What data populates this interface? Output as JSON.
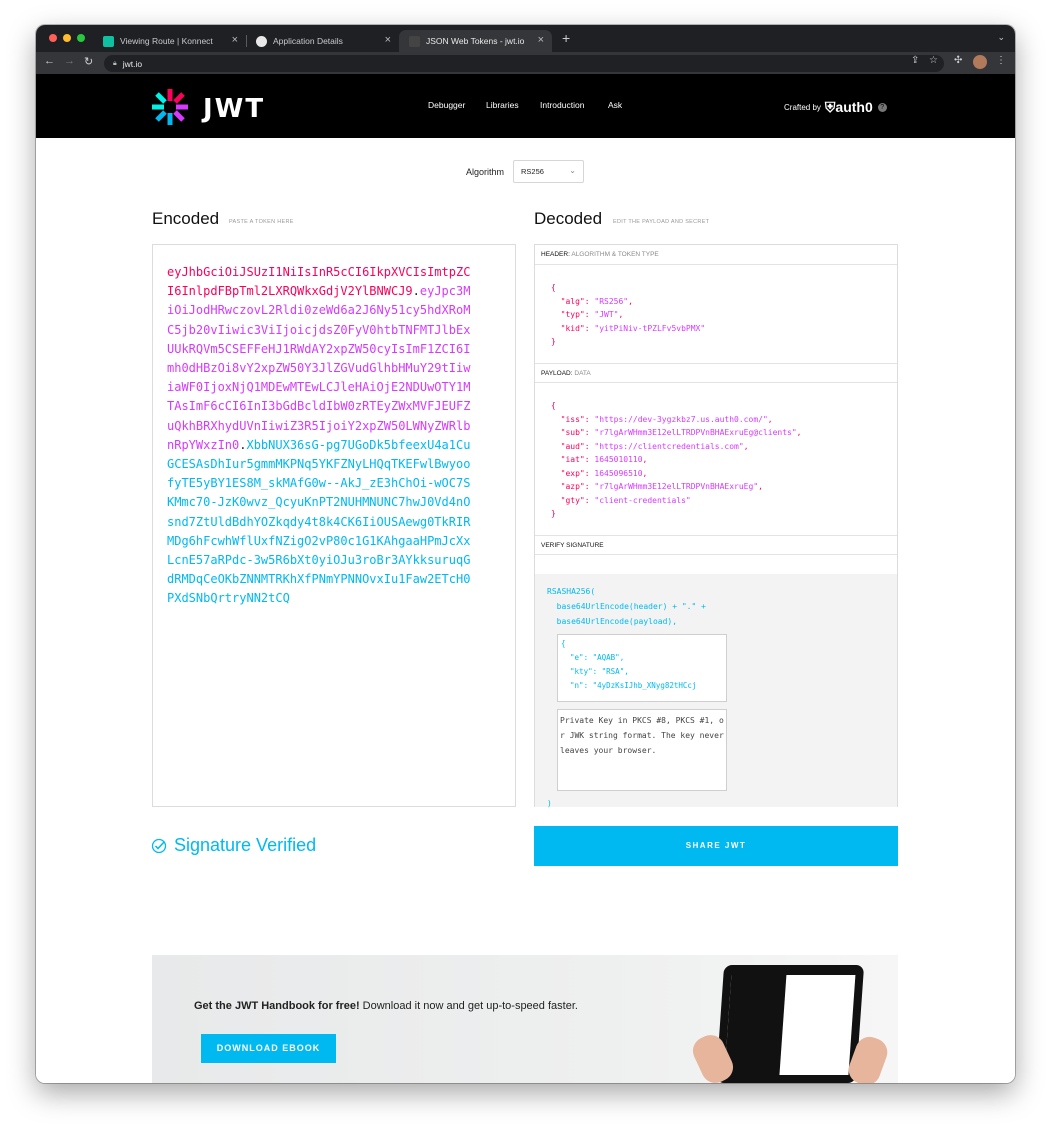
{
  "browser": {
    "tabs": [
      {
        "title": "Viewing Route | Konnect",
        "active": false
      },
      {
        "title": "Application Details",
        "active": false
      },
      {
        "title": "JSON Web Tokens - jwt.io",
        "active": true
      }
    ],
    "new_tab_icon": "plus-icon",
    "url": "jwt.io",
    "colors": {
      "close": "#ff5f57",
      "minimize": "#febc2e",
      "maximize": "#28c840"
    }
  },
  "site": {
    "logo_text": "JWT",
    "nav": [
      "Debugger",
      "Libraries",
      "Introduction",
      "Ask"
    ],
    "crafted_by": "Crafted by",
    "auth0_label": "auth0",
    "brand_colors": {
      "pink": "#fb015b",
      "purple": "#d63aff",
      "cyan": "#00b9f1"
    }
  },
  "algorithm": {
    "label": "Algorithm",
    "value": "RS256"
  },
  "encoded": {
    "title": "Encoded",
    "subtitle": "PASTE A TOKEN HERE",
    "header": "eyJhbGciOiJSUzI1NiIsInR5cCI6IkpXVCIsImtpZCI6InlpdFBpTml2LXRQWkxGdjV2YlBNWCJ9",
    "payload": "eyJpc3MiOiJodHRwczovL2Rldi0zeWd6a2J6Ny51cy5hdXRoMC5jb20vIiwic3ViIjoicjdsZ0FyV0htbTNFMTJlbExUUkRQVm5CSEFFeHJ1RWdAY2xpZW50cyIsImF1ZCI6Imh0dHBzOi8vY2xpZW50Y3JlZGVudGlhbHMuY29tIiwiaWF0IjoxNjQ1MDEwMTEwLCJleHAiOjE2NDUwOTY1MTAsImF6cCI6InI3bGdBcldIbW0zRTEyZWxMVFJEUFZuQkhBRXhydUVnIiwiZ3R5IjoiY2xpZW50LWNyZWRlbnRpYWxzIn0",
    "signature": "XbbNUX36sG-pg7UGoDk5bfeexU4a1CuGCESAsDhIur5gmmMKPNq5YKFZNyLHQqTKEFwlBwyoofyTE5yBY1ES8M_skMAfG0w--AkJ_zE3hChOi-wOC7SKMmc70-JzK0wvz_QcyuKnPT2NUHMNUNC7hwJ0Vd4nOsnd7ZtUldBdhYOZkqdy4t8k4CK6IiOUSAewg0TkRIRMDg6hFcwhWflUxfNZigO2vP80c1G1KAhgaaHPmJcXxLcnE57aRPdc-3w5R6bXt0yiOJu3roBr3AYkksuruqGdRMDqCeOKbZNNMTRKhXfPNmYPNNOvxIu1Faw2ETcH0PXdSNbQrtryNN2tCQ"
  },
  "decoded": {
    "title": "Decoded",
    "subtitle": "EDIT THE PAYLOAD AND SECRET",
    "header_label": "HEADER:",
    "header_sub": "ALGORITHM & TOKEN TYPE",
    "header_fields": [
      {
        "key": "\"alg\"",
        "value": "\"RS256\""
      },
      {
        "key": "\"typ\"",
        "value": "\"JWT\""
      },
      {
        "key": "\"kid\"",
        "value": "\"yitPiNiv-tPZLFv5vbPMX\""
      }
    ],
    "payload_label": "PAYLOAD:",
    "payload_sub": "DATA",
    "payload_fields": [
      {
        "key": "\"iss\"",
        "value": "\"https://dev-3ygzkbz7.us.auth0.com/\""
      },
      {
        "key": "\"sub\"",
        "value": "\"r7lgArWHmm3E12elLTRDPVnBHAExruEg@clients\""
      },
      {
        "key": "\"aud\"",
        "value": "\"https://clientcredentials.com\""
      },
      {
        "key": "\"iat\"",
        "value": "1645010110"
      },
      {
        "key": "\"exp\"",
        "value": "1645096510"
      },
      {
        "key": "\"azp\"",
        "value": "\"r7lgArWHmm3E12elLTRDPVnBHAExruEg\""
      },
      {
        "key": "\"gty\"",
        "value": "\"client-credentials\""
      }
    ],
    "verify_label": "VERIFY SIGNATURE",
    "verify_lines": [
      "RSASHA256(",
      "  base64UrlEncode(header) + \".\" +",
      "  base64UrlEncode(payload),"
    ],
    "public_key_lines": [
      "{",
      "  \"e\": \"AQAB\",",
      "  \"kty\": \"RSA\",",
      "  \"n\": \"4yDzKsIJhb_XNyg82tHCcj"
    ],
    "private_key_placeholder": "Private Key in PKCS #8, PKCS #1, or JWK string format. The key never leaves your browser.",
    "close_paren": ")"
  },
  "signature_verified": "Signature Verified",
  "share_button": "SHARE JWT",
  "promo": {
    "bold": "Get the JWT Handbook for free!",
    "text": " Download it now and get up-to-speed faster.",
    "button": "DOWNLOAD EBOOK"
  }
}
